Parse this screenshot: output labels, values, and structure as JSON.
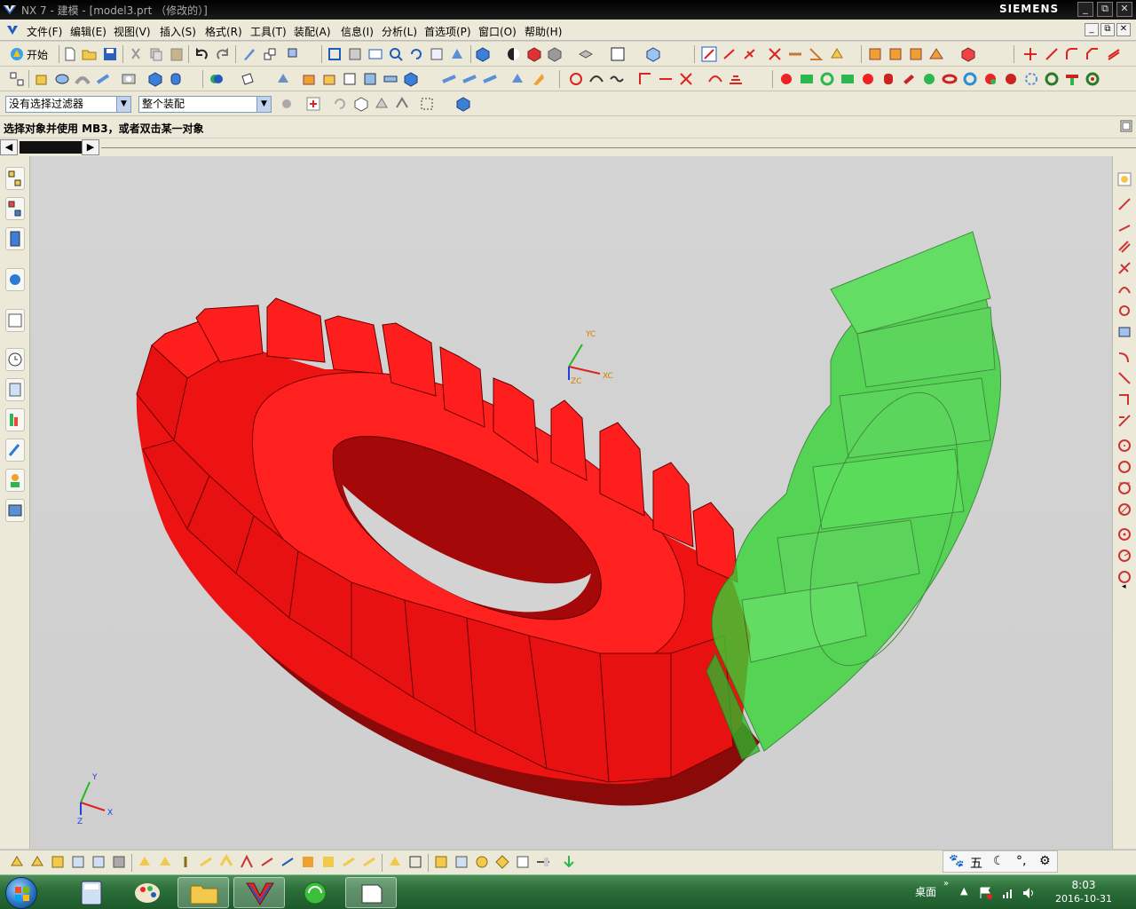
{
  "window": {
    "title": "NX 7 - 建模 - [model3.prt （修改的）]",
    "brand": "SIEMENS",
    "controls": [
      "_",
      "⧉",
      "✕"
    ]
  },
  "menu": {
    "items": [
      "文件(F)",
      "编辑(E)",
      "视图(V)",
      "插入(S)",
      "格式(R)",
      "工具(T)",
      "装配(A)",
      "信息(I)",
      "分析(L)",
      "首选项(P)",
      "窗口(O)",
      "帮助(H)"
    ]
  },
  "toolbar": {
    "start_label": "开始",
    "selection_filter": "没有选择过滤器",
    "selection_scope": "整个装配"
  },
  "cue_line": "选择对象并使用 MB3，或者双击某一对象",
  "viewport": {
    "wcs_labels": {
      "yc": "YC",
      "xc": "XC",
      "zc": "ZC"
    },
    "abs_labels": {
      "y": "Y",
      "x": "X",
      "z": "Z"
    }
  },
  "ime": {
    "chars": [
      "五",
      "☾",
      "⚙"
    ]
  },
  "taskbar": {
    "desktop": "桌面",
    "time": "8:03",
    "date": "2016-10-31"
  },
  "colors": {
    "gear_red": "#ff1f1f",
    "gear_green": "#3ddc3d",
    "viewport_bg": "#d2d2d2",
    "taskbar": "#2c6f3a"
  }
}
